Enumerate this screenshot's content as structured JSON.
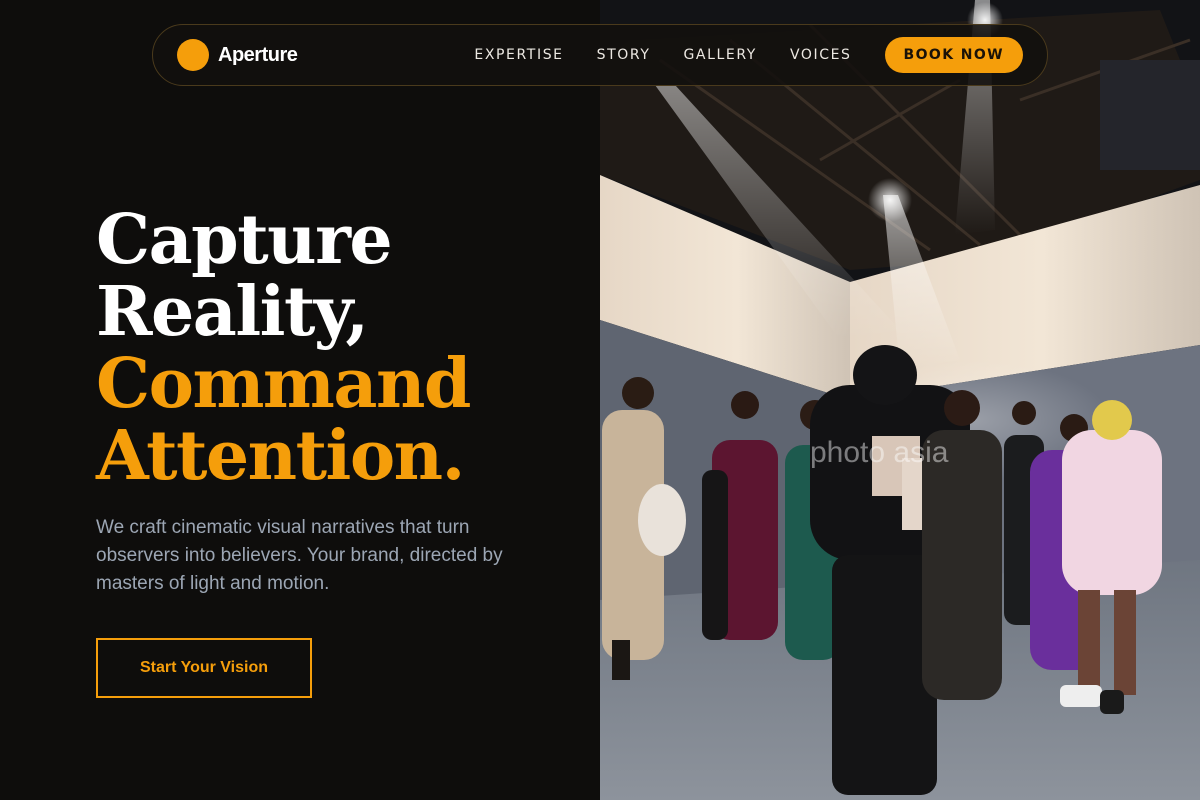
{
  "brand": {
    "name": "Aperture"
  },
  "nav": {
    "links": [
      "EXPERTISE",
      "STORY",
      "GALLERY",
      "VOICES"
    ],
    "cta": "BOOK NOW"
  },
  "hero": {
    "headline_white": [
      "Capture",
      "Reality,"
    ],
    "headline_gold": [
      "Command",
      "Attention."
    ],
    "subtext": "We craft cinematic visual narratives that turn observers into believers. Your brand, directed by masters of light and motion.",
    "cta": "Start Your Vision"
  },
  "photo": {
    "watermark": "photo asia"
  },
  "colors": {
    "accent": "#f59e0b",
    "background": "#0e0d0c",
    "subtext": "#9ca6b4"
  }
}
